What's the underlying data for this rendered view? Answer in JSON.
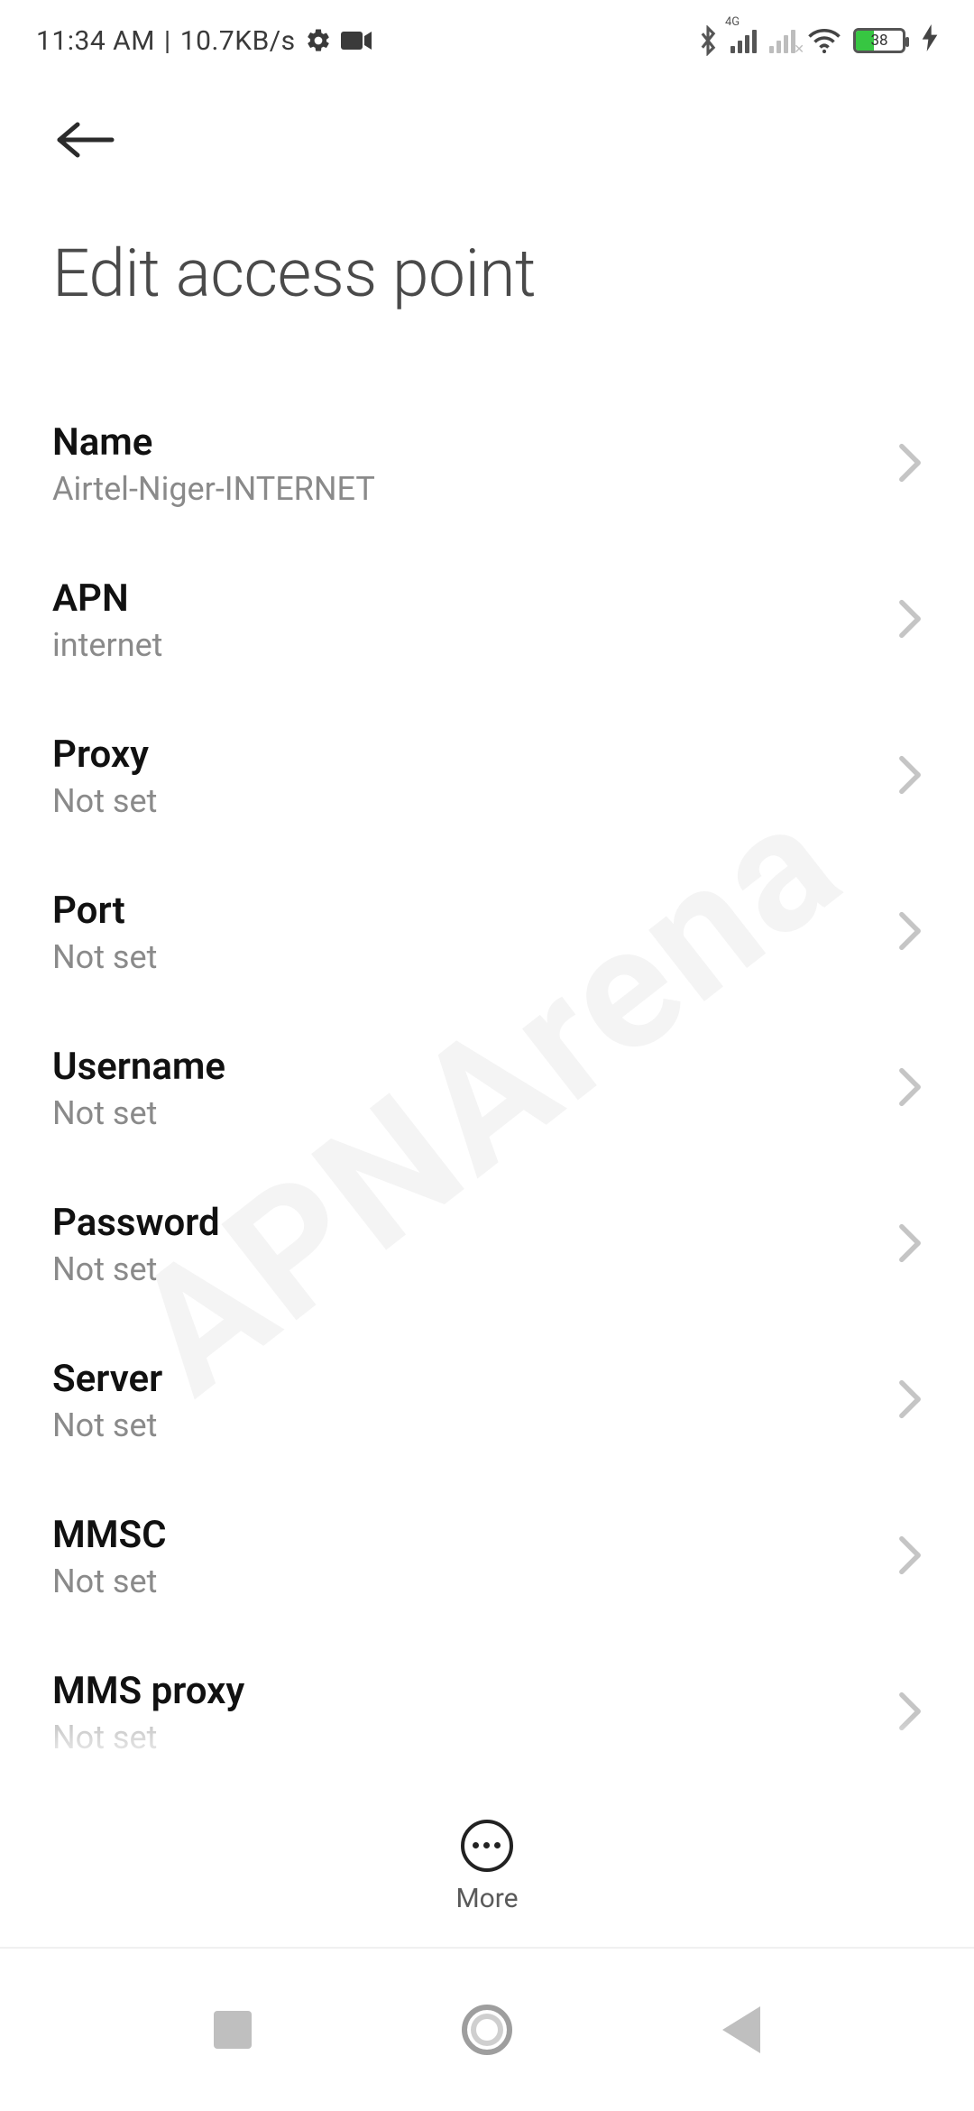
{
  "status": {
    "time": "11:34 AM",
    "net_speed": "10.7KB/s",
    "signal_label_4g": "4G",
    "battery_pct": "38"
  },
  "header": {
    "title": "Edit access point"
  },
  "settings": [
    {
      "label": "Name",
      "value": "Airtel-Niger-INTERNET"
    },
    {
      "label": "APN",
      "value": "internet"
    },
    {
      "label": "Proxy",
      "value": "Not set"
    },
    {
      "label": "Port",
      "value": "Not set"
    },
    {
      "label": "Username",
      "value": "Not set"
    },
    {
      "label": "Password",
      "value": "Not set"
    },
    {
      "label": "Server",
      "value": "Not set"
    },
    {
      "label": "MMSC",
      "value": "Not set"
    },
    {
      "label": "MMS proxy",
      "value": "Not set"
    }
  ],
  "bottom": {
    "more_label": "More"
  },
  "watermark": "APNArena"
}
